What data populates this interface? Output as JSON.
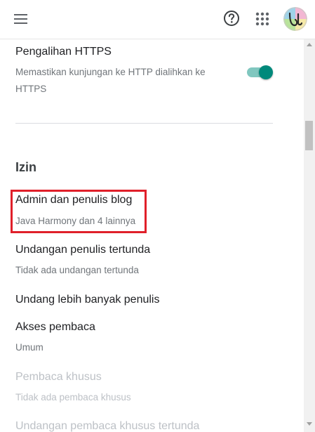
{
  "header": {
    "menu_icon": "menu-icon",
    "help_icon": "help-icon",
    "apps_icon": "apps-grid-icon",
    "avatar": "avatar"
  },
  "https_redirect": {
    "title": "Pengalihan HTTPS",
    "description_line1": "Memastikan kunjungan ke HTTP dialihkan ke",
    "description_line2": "HTTPS",
    "enabled": true,
    "toggle_color": "#00897b"
  },
  "permissions": {
    "heading": "Izin",
    "items": [
      {
        "title": "Admin dan penulis blog",
        "subtitle": "Java Harmony dan 4 lainnya",
        "highlighted": true
      },
      {
        "title": "Undangan penulis tertunda",
        "subtitle": "Tidak ada undangan tertunda"
      },
      {
        "title": "Undang lebih banyak penulis"
      },
      {
        "title": "Akses pembaca",
        "subtitle": "Umum"
      },
      {
        "title": "Pembaca khusus",
        "subtitle": "Tidak ada pembaca khusus",
        "disabled": true
      },
      {
        "title": "Undangan pembaca khusus tertunda",
        "disabled": true
      }
    ]
  },
  "colors": {
    "highlight": "#e0202a",
    "text_primary": "#202124",
    "text_secondary": "#70757a",
    "text_disabled": "#bdc1c6"
  }
}
